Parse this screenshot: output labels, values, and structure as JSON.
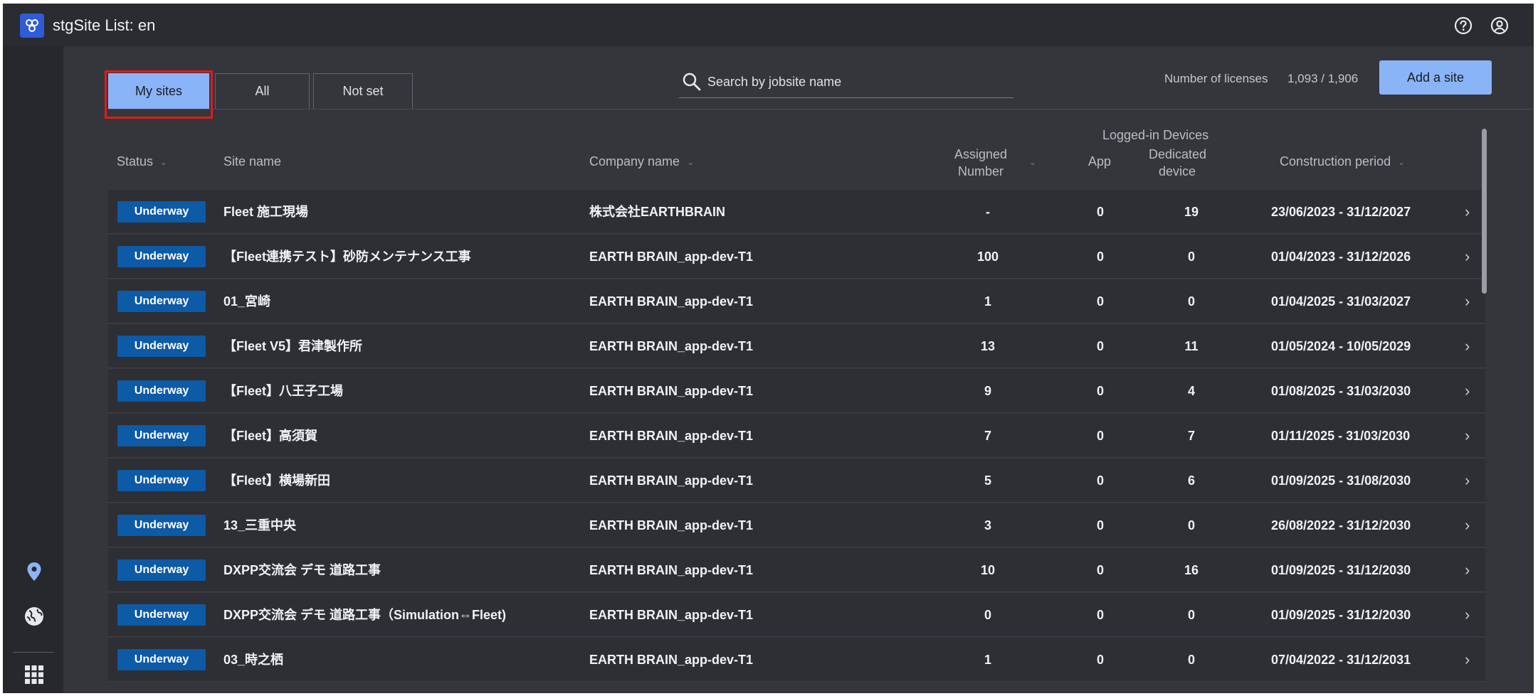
{
  "app": {
    "title": "stgSite List: en"
  },
  "tabs": [
    {
      "label": "My sites",
      "active": true
    },
    {
      "label": "All",
      "active": false
    },
    {
      "label": "Not set",
      "active": false
    }
  ],
  "search": {
    "placeholder": "Search by jobsite name"
  },
  "licenses": {
    "label": "Number of licenses",
    "value": "1,093 / 1,906"
  },
  "add_site_label": "Add a site",
  "table": {
    "headers": {
      "status": "Status",
      "site_name": "Site name",
      "company_name": "Company name",
      "assigned_number": "Assigned Number",
      "logged_in_devices": "Logged-in Devices",
      "app": "App",
      "dedicated_device": "Dedicated device",
      "construction_period": "Construction period"
    },
    "rows": [
      {
        "status": "Underway",
        "site": "Fleet 施工現場",
        "company": "株式会社EARTHBRAIN",
        "assigned": "-",
        "app": "0",
        "dedicated": "19",
        "period": "23/06/2023 - 31/12/2027"
      },
      {
        "status": "Underway",
        "site": "【Fleet連携テスト】砂防メンテナンス工事",
        "company": "EARTH BRAIN_app-dev-T1",
        "assigned": "100",
        "app": "0",
        "dedicated": "0",
        "period": "01/04/2023 - 31/12/2026"
      },
      {
        "status": "Underway",
        "site": "01_宮崎",
        "company": "EARTH BRAIN_app-dev-T1",
        "assigned": "1",
        "app": "0",
        "dedicated": "0",
        "period": "01/04/2025 - 31/03/2027"
      },
      {
        "status": "Underway",
        "site": "【Fleet V5】君津製作所",
        "company": "EARTH BRAIN_app-dev-T1",
        "assigned": "13",
        "app": "0",
        "dedicated": "11",
        "period": "01/05/2024 - 10/05/2029"
      },
      {
        "status": "Underway",
        "site": "【Fleet】八王子工場",
        "company": "EARTH BRAIN_app-dev-T1",
        "assigned": "9",
        "app": "0",
        "dedicated": "4",
        "period": "01/08/2025 - 31/03/2030"
      },
      {
        "status": "Underway",
        "site": "【Fleet】高須賀",
        "company": "EARTH BRAIN_app-dev-T1",
        "assigned": "7",
        "app": "0",
        "dedicated": "7",
        "period": "01/11/2025 - 31/03/2030"
      },
      {
        "status": "Underway",
        "site": "【Fleet】横場新田",
        "company": "EARTH BRAIN_app-dev-T1",
        "assigned": "5",
        "app": "0",
        "dedicated": "6",
        "period": "01/09/2025 - 31/08/2030"
      },
      {
        "status": "Underway",
        "site": "13_三重中央",
        "company": "EARTH BRAIN_app-dev-T1",
        "assigned": "3",
        "app": "0",
        "dedicated": "0",
        "period": "26/08/2022 - 31/12/2030"
      },
      {
        "status": "Underway",
        "site": "DXPP交流会 デモ 道路工事",
        "company": "EARTH BRAIN_app-dev-T1",
        "assigned": "10",
        "app": "0",
        "dedicated": "16",
        "period": "01/09/2025 - 31/12/2030"
      },
      {
        "status": "Underway",
        "site": "DXPP交流会 デモ 道路工事（Simulation⇔Fleet)",
        "company": "EARTH BRAIN_app-dev-T1",
        "assigned": "0",
        "app": "0",
        "dedicated": "0",
        "period": "01/09/2025 - 31/12/2030"
      },
      {
        "status": "Underway",
        "site": "03_時之栖",
        "company": "EARTH BRAIN_app-dev-T1",
        "assigned": "1",
        "app": "0",
        "dedicated": "0",
        "period": "07/04/2022 - 31/12/2031"
      }
    ]
  },
  "icons": {
    "logo": "app-logo-icon",
    "help": "help-icon",
    "account": "account-icon",
    "map_pin": "map-pin-icon",
    "globe": "globe-icon",
    "apps": "apps-grid-icon",
    "search": "search-icon",
    "row_open": "chevron-right-icon"
  },
  "colors": {
    "accent": "#8ab4f8",
    "status_underway": "#0d5aa7",
    "highlight": "#e01b1b"
  }
}
